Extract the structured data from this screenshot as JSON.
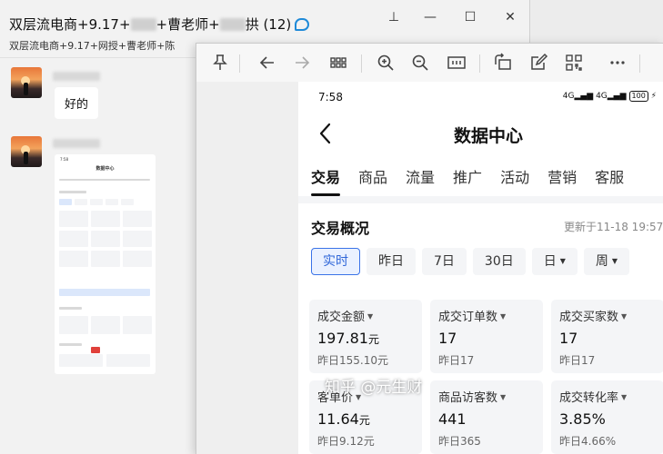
{
  "chat": {
    "title_part1": "双层流电商+9.17+",
    "title_part2": "+曹老师+",
    "title_part3": "拱 (12)",
    "subtitle": "双层流电商+9.17+网授+曹老师+陈",
    "window_buttons": {
      "pin": "⊥",
      "minimize": "—",
      "maximize": "☐",
      "close": "✕"
    },
    "messages": [
      {
        "text": "好的"
      }
    ]
  },
  "viewer": {
    "toolbar_icons": [
      "pin-icon",
      "back-arrow-icon",
      "forward-arrow-icon",
      "grid-icon",
      "zoom-in-icon",
      "zoom-out-icon",
      "fit-icon",
      "rotate-icon",
      "edit-icon",
      "qr-scan-icon",
      "more-icon"
    ]
  },
  "phone": {
    "time": "7:58",
    "signal1": "4G",
    "signal2": "4G",
    "battery": "100",
    "title": "数据中心",
    "tabs": [
      "交易",
      "商品",
      "流量",
      "推广",
      "活动",
      "营销",
      "客服"
    ],
    "active_tab": 0,
    "section_title": "交易概况",
    "updated": "更新于11-18 19:57",
    "filters": [
      {
        "label": "实时",
        "active": true,
        "caret": false
      },
      {
        "label": "昨日",
        "active": false,
        "caret": false
      },
      {
        "label": "7日",
        "active": false,
        "caret": false
      },
      {
        "label": "30日",
        "active": false,
        "caret": false
      },
      {
        "label": "日",
        "active": false,
        "caret": true
      },
      {
        "label": "周",
        "active": false,
        "caret": true
      }
    ],
    "metrics": [
      {
        "label": "成交金额",
        "value": "197.81",
        "unit": "元",
        "prev": "昨日155.10元"
      },
      {
        "label": "成交订单数",
        "value": "17",
        "unit": "",
        "prev": "昨日17"
      },
      {
        "label": "成交买家数",
        "value": "17",
        "unit": "",
        "prev": "昨日17"
      },
      {
        "label": "客单价",
        "value": "11.64",
        "unit": "元",
        "prev": "昨日9.12元"
      },
      {
        "label": "商品访客数",
        "value": "441",
        "unit": "",
        "prev": "昨日365"
      },
      {
        "label": "成交转化率",
        "value": "3.85%",
        "unit": "",
        "prev": "昨日4.66%"
      }
    ],
    "watermark": "知乎 @元生财"
  },
  "thumbnail": {
    "title": "数据中心",
    "time": "7:58"
  }
}
